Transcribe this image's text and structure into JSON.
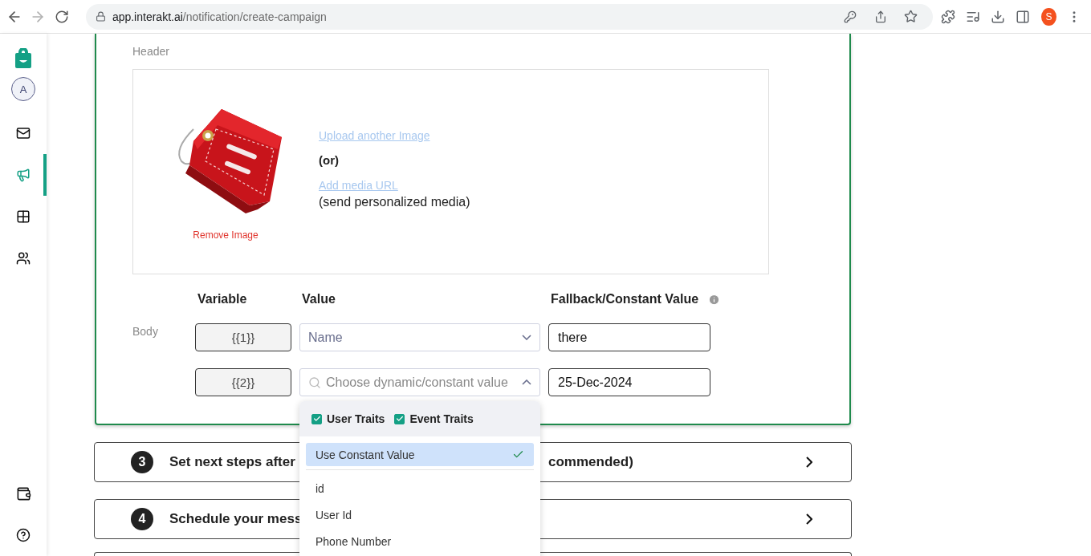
{
  "browser": {
    "url_host": "app.interakt.ai",
    "url_path": "/notification/create-campaign",
    "forward_disabled": true,
    "profile_initial": "S"
  },
  "sidebar": {
    "avatar": "A",
    "items": [
      {
        "kind": "mail",
        "selected": false
      },
      {
        "kind": "campaign",
        "selected": true
      },
      {
        "kind": "grid",
        "selected": false
      },
      {
        "kind": "users",
        "selected": false
      }
    ],
    "bottom_items": [
      {
        "kind": "wallet"
      },
      {
        "kind": "help"
      }
    ]
  },
  "header_section": {
    "label": "Header",
    "remove_link": "Remove Image",
    "upload_link": "Upload another Image",
    "or_text": "(or)",
    "media_url_link": "Add media URL",
    "media_url_note": "(send personalized media)"
  },
  "body_section": {
    "label": "Body",
    "columns": [
      "Variable",
      "Value",
      "Fallback/Constant Value"
    ],
    "rows": [
      {
        "variable": "{{1}}",
        "value": "Name",
        "open": false,
        "fallback": "there"
      },
      {
        "variable": "{{2}}",
        "placeholder": "Choose dynamic/constant value",
        "open": true,
        "fallback": "25-Dec-2024"
      }
    ]
  },
  "dropdown": {
    "filters": [
      {
        "label": "User Traits",
        "checked": true
      },
      {
        "label": "Event Traits",
        "checked": true
      }
    ],
    "options": [
      {
        "label": "Use Constant Value",
        "selected": true
      },
      {
        "label": "id",
        "selected": false
      },
      {
        "label": "User Id",
        "selected": false
      },
      {
        "label": "Phone Number",
        "selected": false
      }
    ]
  },
  "steps": [
    {
      "number": "3",
      "title_start": "Set next steps after",
      "title_end": "commended)"
    },
    {
      "number": "4",
      "title_start": "Schedule your mess"
    }
  ]
}
